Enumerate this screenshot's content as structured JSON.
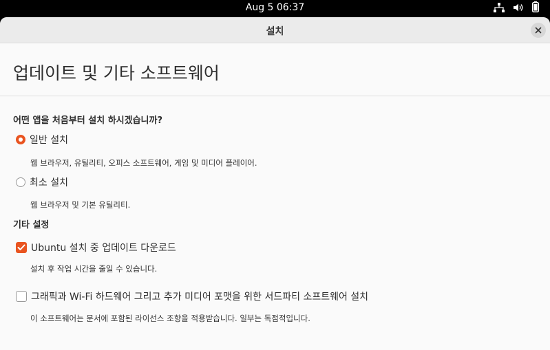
{
  "topbar": {
    "clock": "Aug 5  06:37"
  },
  "window": {
    "title": "설치",
    "page_title": "업데이트 및 기타 소프트웨어",
    "question": "어떤 앱을 처음부터 설치 하시겠습니까?",
    "options": [
      {
        "label": "일반 설치",
        "description": "웹 브라우저, 유틸리티, 오피스  소프트웨어, 게임 및 미디어 플레이어.",
        "selected": true
      },
      {
        "label": "최소 설치",
        "description": "웹 브라우저 및 기본 유틸리티.",
        "selected": false
      }
    ],
    "other_settings": {
      "heading": "기타 설정",
      "checks": [
        {
          "label": "Ubuntu 설치 중 업데이트 다운로드",
          "description": "설치 후 작업 시간을 줄일 수 있습니다.",
          "checked": true
        },
        {
          "label": "그래픽과 Wi-Fi 하드웨어 그리고 추가 미디어 포맷을 위한 서드파티 소프트웨어 설치",
          "description": "이 소프트웨어는 문서에 포함된 라이선스 조항을 적용받습니다. 일부는 독점적입니다.",
          "checked": false
        }
      ]
    }
  },
  "colors": {
    "accent": "#e95420",
    "topbar": "#000000",
    "headerbar": "#ebebeb",
    "window_bg": "#fafafa"
  },
  "icons": [
    "network-icon",
    "volume-icon",
    "battery-icon",
    "close-icon",
    "radio-checked",
    "checkbox-checked"
  ]
}
